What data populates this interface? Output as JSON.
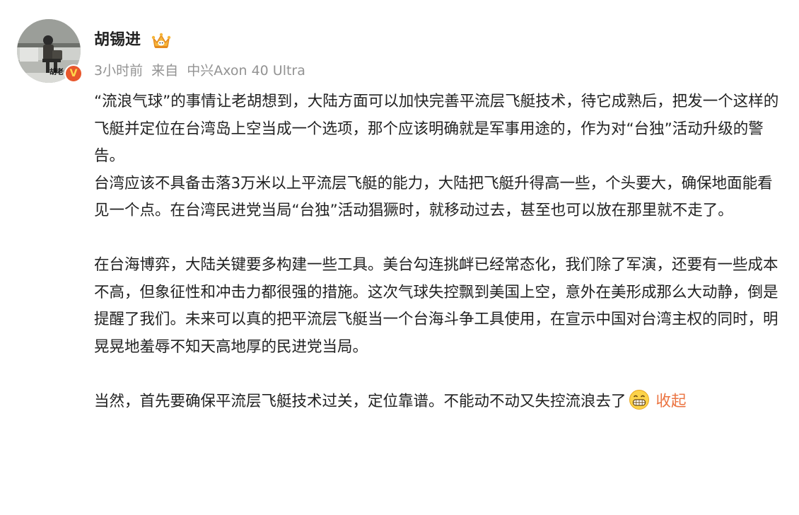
{
  "user": {
    "name": "胡锡进",
    "avatar_caption": "胡老",
    "verified_mark": "V"
  },
  "meta": {
    "time": "3小时前",
    "source_prefix": "来自",
    "device": "中兴Axon 40 Ultra"
  },
  "post": {
    "paragraphs": [
      "“流浪气球”的事情让老胡想到，大陆方面可以加快完善平流层飞艇技术，待它成熟后，把发一个这样的飞艇并定位在台湾岛上空当成一个选项，那个应该明确就是军事用途的，作为对“台独”活动升级的警告。",
      "台湾应该不具备击落3万米以上平流层飞艇的能力，大陆把飞艇升得高一些，个头要大，确保地面能看见一个点。在台湾民进党当局“台独”活动猖獗时，就移动过去，甚至也可以放在那里就不走了。",
      "在台海博弈，大陆关键要多构建一些工具。美台勾连挑衅已经常态化，我们除了军演，还要有一些成本不高，但象征性和冲击力都很强的措施。这次气球失控飘到美国上空，意外在美形成那么大动静，倒是提醒了我们。未来可以真的把平流层飞艇当一个台海斗争工具使用，在宣示中国对台湾主权的同时，明晃晃地羞辱不知天高地厚的民进党当局。",
      "当然，首先要确保平流层飞艇技术过关，定位靠谱。不能动不动又失控流浪去了"
    ],
    "collapse_label": "收起"
  },
  "icons": {
    "crown": "crown-badge-icon",
    "emoji": "grinning-emoji-icon",
    "verified": "verified-badge-icon"
  },
  "colors": {
    "text": "#222222",
    "meta": "#939393",
    "accent": "#eb7340",
    "verified_bg": "#e8572c"
  }
}
